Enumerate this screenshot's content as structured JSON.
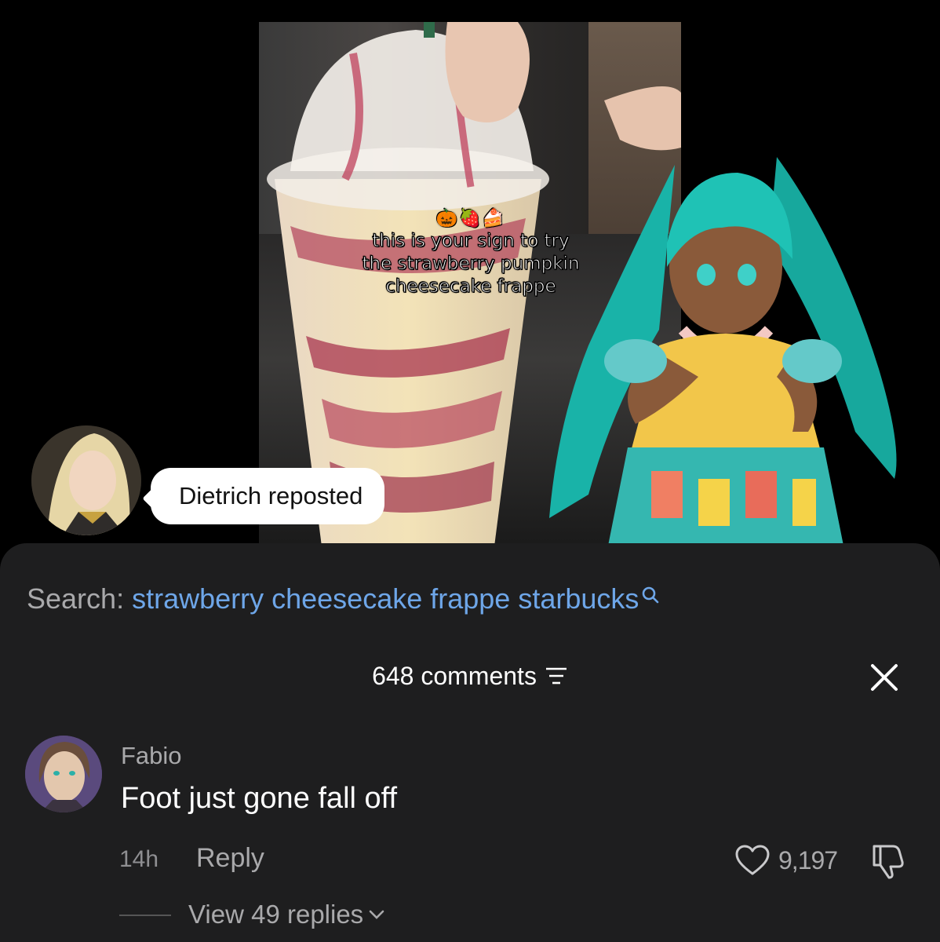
{
  "caption": {
    "emoji": "🎃🍓🍰",
    "lines": [
      "this is your sign to try",
      "the strawberry pumpkin",
      "cheesecake frappe"
    ]
  },
  "repost": {
    "text": "Dietrich reposted"
  },
  "search": {
    "label": "Search: ",
    "query": "strawberry cheesecake frappe starbucks"
  },
  "comments_header": {
    "count_text": "648 comments"
  },
  "comment": {
    "author": "Fabio",
    "text": "Foot just gone fall off",
    "time": "14h",
    "reply_label": "Reply",
    "likes": "9,197",
    "view_replies": "View 49 replies"
  },
  "colors": {
    "sheet_bg": "#1e1e1f",
    "link_blue": "#6ea6e8",
    "muted": "#a9a9ab"
  }
}
